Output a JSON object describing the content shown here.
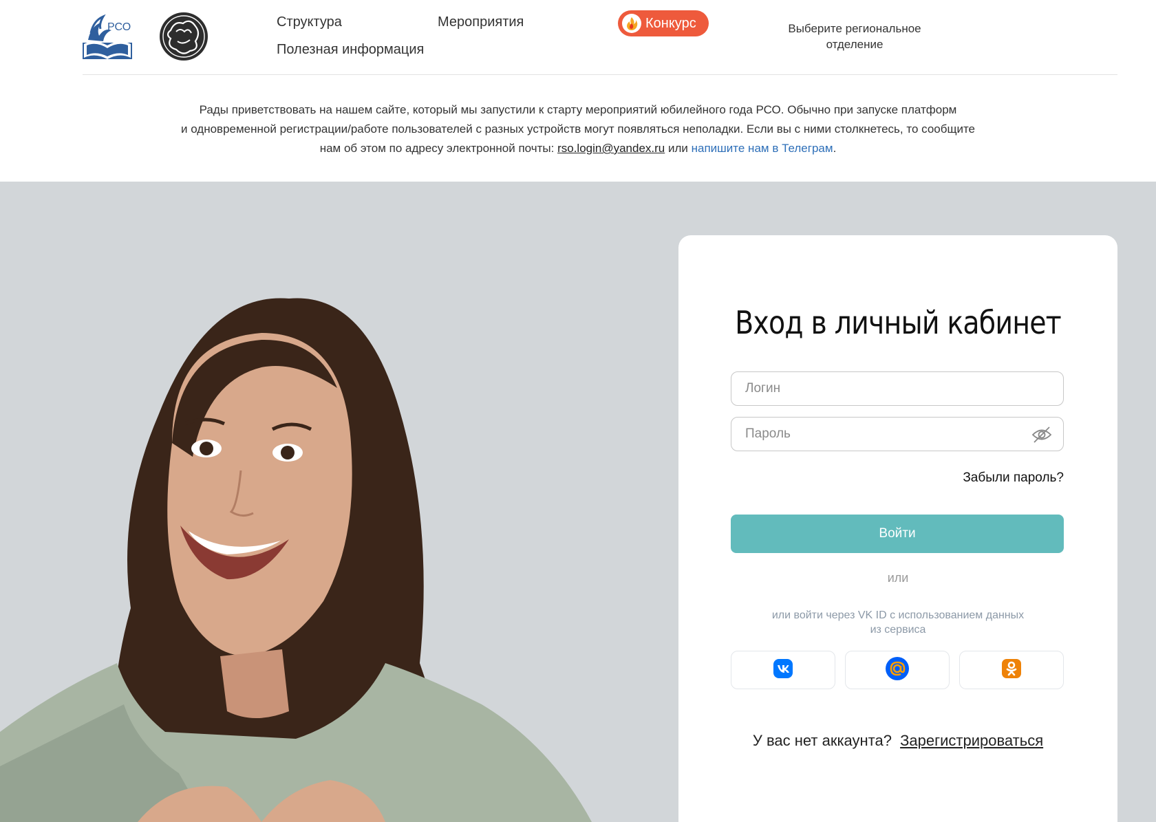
{
  "header": {
    "logo_rso_text": "РСО",
    "nav": {
      "structure": "Структура",
      "events": "Мероприятия",
      "useful": "Полезная информация"
    },
    "contest_label": "Конкурс",
    "region_line1": "Выберите региональное",
    "region_line2": "отделение"
  },
  "notice": {
    "line1": "Рады приветствовать на нашем сайте, который мы запустили к старту мероприятий юбилейного года РСО. Обычно при запуске платформ",
    "line2": "и одновременной регистрации/работе пользователей с разных устройств могут появляться неполадки. Если вы с ними столкнетесь, то сообщите",
    "line3_prefix": "нам об этом по адресу электронной почты: ",
    "email": "rso.login@yandex.ru",
    "or": " или ",
    "telegram_link": "напишите нам в Телеграм",
    "end": "."
  },
  "login": {
    "title": "Вход в личный кабинет",
    "login_placeholder": "Логин",
    "password_placeholder": "Пароль",
    "forgot": "Забыли пароль?",
    "submit": "Войти",
    "or": "или",
    "vk_hint_line1": "или войти через VK ID с использованием данных",
    "vk_hint_line2": "из сервиса",
    "no_account": "У вас нет аккаунта?",
    "register": "Зарегистрироваться"
  },
  "colors": {
    "contest_bg": "#ee5a3c",
    "submit_bg": "#62bbbc",
    "hero_bg": "#d2d6d9",
    "vk": "#0077ff",
    "mail": "#005ff9",
    "ok": "#ee8208",
    "telegram_link": "#2e6fb8"
  },
  "icons": {
    "contest": "flame-icon",
    "password_toggle": "eye-off-icon",
    "vk": "vk-icon",
    "mail": "mail-ru-icon",
    "ok": "odnoklassniki-icon"
  }
}
